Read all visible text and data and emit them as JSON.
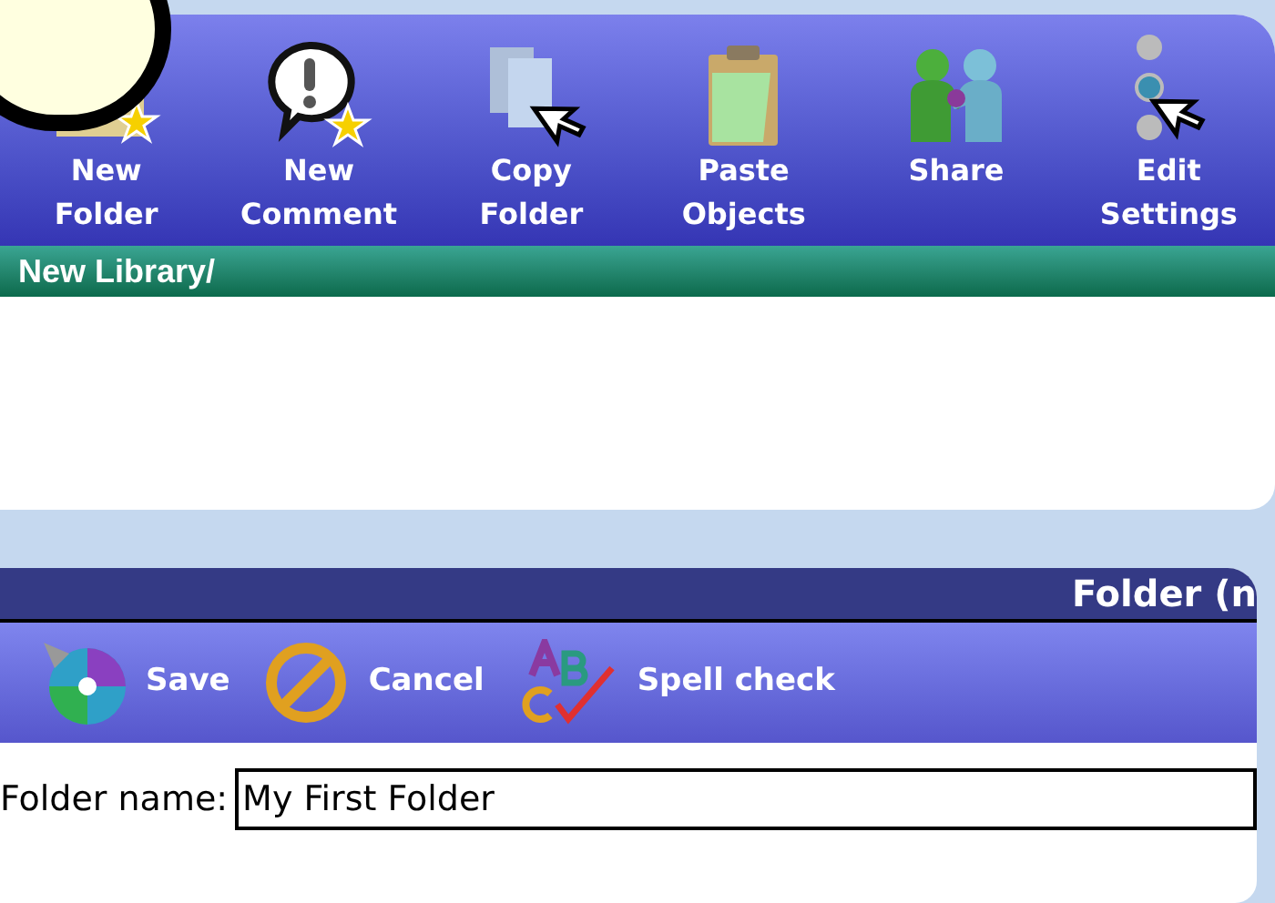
{
  "library_toolbar": [
    {
      "kind": "new-folder",
      "label": "New Folder"
    },
    {
      "kind": "new-comment",
      "label": "New Comment"
    },
    {
      "kind": "copy",
      "label": "Copy Folder"
    },
    {
      "kind": "paste",
      "label": "Paste Objects"
    },
    {
      "kind": "share",
      "label": "Share"
    },
    {
      "kind": "settings",
      "label": "Edit Settings"
    }
  ],
  "path_bar": {
    "path": "New Library/"
  },
  "dialog": {
    "title": "Folder (n",
    "toolbar": [
      {
        "kind": "save",
        "label": "Save"
      },
      {
        "kind": "cancel",
        "label": "Cancel"
      },
      {
        "kind": "spell",
        "label": "Spell check"
      }
    ],
    "field": {
      "label": "Folder name:",
      "value": "My First Folder"
    }
  }
}
